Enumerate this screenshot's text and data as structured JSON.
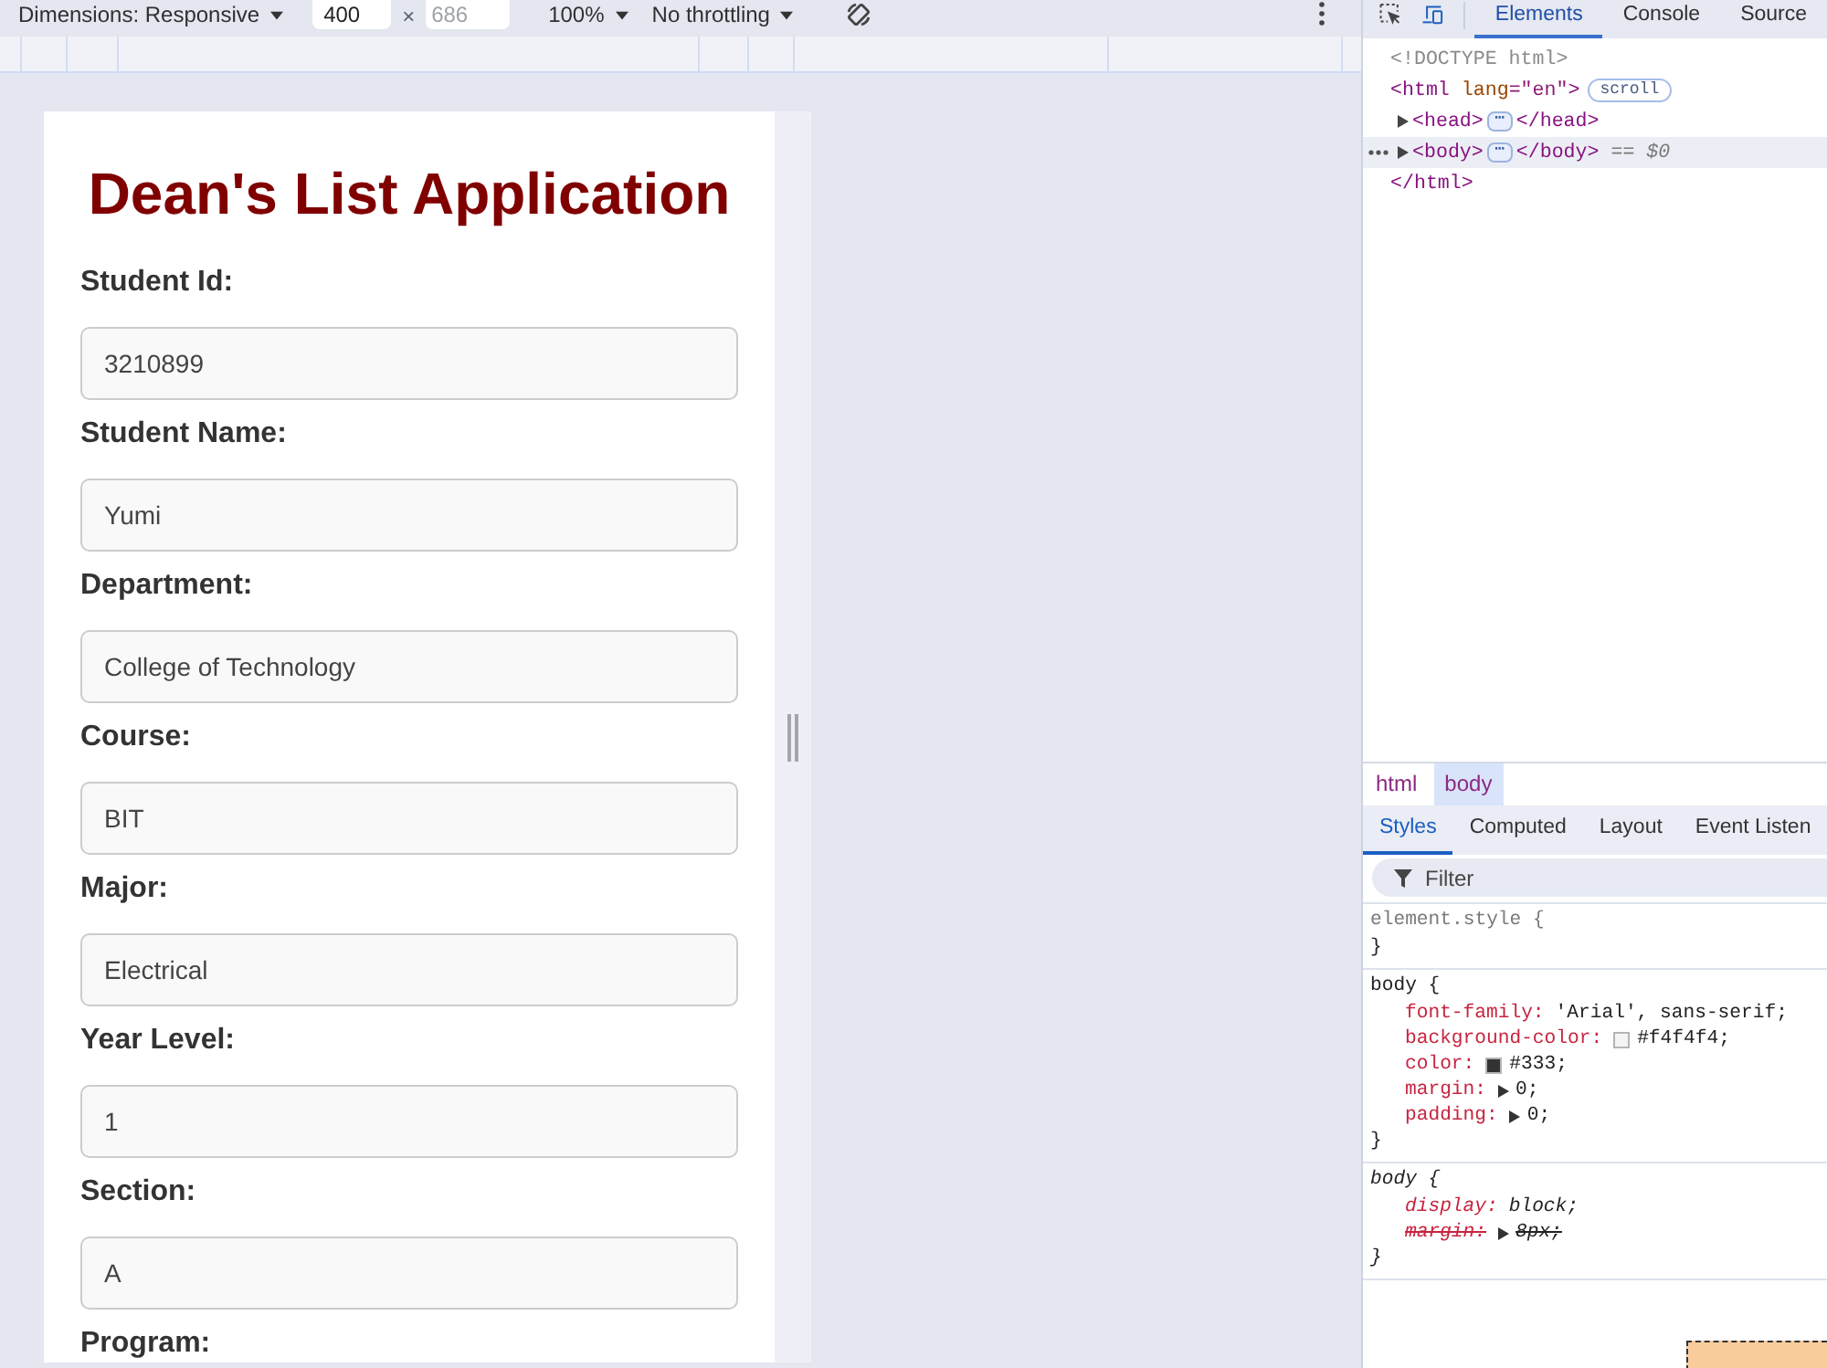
{
  "device_toolbar": {
    "dimensions": "Dimensions: Responsive",
    "width_field": {
      "value": "400"
    },
    "times": "×",
    "height_field": {
      "placeholder": "686"
    },
    "zoom": "100%",
    "throttling": "No throttling"
  },
  "page": {
    "title": "Dean's List Application",
    "fields": [
      {
        "label": "Student Id:",
        "value": "3210899"
      },
      {
        "label": "Student Name:",
        "value": "Yumi"
      },
      {
        "label": "Department:",
        "value": "College of Technology"
      },
      {
        "label": "Course:",
        "value": "BIT"
      },
      {
        "label": "Major:",
        "value": "Electrical"
      },
      {
        "label": "Year Level:",
        "value": "1"
      },
      {
        "label": "Section:",
        "value": "A"
      },
      {
        "label": "Program:"
      }
    ]
  },
  "devtools": {
    "tabs": [
      {
        "label": "Elements",
        "selected": true
      },
      {
        "label": "Console",
        "selected": false
      },
      {
        "label": "Source",
        "selected": false
      }
    ],
    "dom_tree": [
      {
        "tokens": [
          {
            "kind": "doctype",
            "text": "<!DOCTYPE html>"
          }
        ],
        "selected": false
      },
      {
        "tokens": [
          {
            "kind": "tag",
            "text": "<html"
          },
          {
            "kind": "attr_name",
            "text": " lang"
          },
          {
            "kind": "attr_value",
            "text": "=\"en\""
          },
          {
            "kind": "tag",
            "text": ">"
          }
        ],
        "badge": "scroll",
        "selected": false,
        "children": [
          {
            "tokens": [
              {
                "kind": "tag",
                "text": "<head>"
              },
              {
                "kind": "ellipsis",
                "text": "⋯"
              },
              {
                "kind": "tag",
                "text": "</head>"
              }
            ],
            "expanded": false,
            "selected": false
          },
          {
            "tokens": [
              {
                "kind": "tag",
                "text": "<body>"
              },
              {
                "kind": "ellipsis",
                "text": "⋯"
              },
              {
                "kind": "tag",
                "text": "</body>"
              },
              {
                "kind": "note",
                "text": " == $0"
              }
            ],
            "expanded": false,
            "selected": true
          }
        ],
        "closing": [
          {
            "kind": "tag",
            "text": "</html>"
          }
        ]
      }
    ],
    "breadcrumbs": [
      {
        "label": "html",
        "selected": false
      },
      {
        "label": "body",
        "selected": true
      }
    ],
    "styles_tabs": [
      {
        "label": "Styles",
        "selected": true
      },
      {
        "label": "Computed",
        "selected": false
      },
      {
        "label": "Layout",
        "selected": false
      },
      {
        "label": "Event Listen",
        "selected": false
      }
    ],
    "filter": {
      "placeholder": "Filter"
    },
    "rules": [
      {
        "kind": "inline",
        "header": "element.style {",
        "footer": "}"
      },
      {
        "kind": "author",
        "header": "body {",
        "declarations": [
          {
            "kind": "plain",
            "property": "font-family:",
            "value": "'Arial', sans-serif;",
            "overridden": false
          },
          {
            "kind": "color",
            "property": "background-color:",
            "color": "#f4f4f4",
            "value": "#f4f4f4;",
            "overridden": false
          },
          {
            "kind": "color",
            "property": "color:",
            "color": "#333333",
            "value": "#333;",
            "overridden": false
          },
          {
            "kind": "shorthand",
            "property": "margin:",
            "value": "0;",
            "overridden": false
          },
          {
            "kind": "shorthand",
            "property": "padding:",
            "value": "0;",
            "overridden": false
          }
        ],
        "footer": "}"
      },
      {
        "kind": "user_agent",
        "header": "body {",
        "declarations": [
          {
            "kind": "plain",
            "property": "display:",
            "value": "block;",
            "overridden": false
          },
          {
            "kind": "shorthand",
            "property": "margin:",
            "value": "8px;",
            "overridden": true
          }
        ],
        "footer": "}"
      }
    ]
  }
}
